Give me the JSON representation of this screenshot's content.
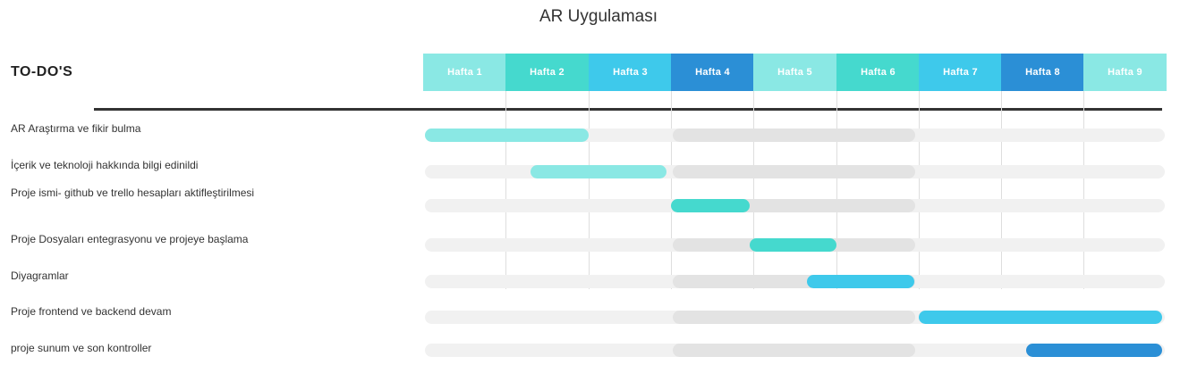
{
  "title": "AR Uygulaması",
  "todo_heading": "TO-DO'S",
  "colors": {
    "week_headers": [
      "#8ae8e4",
      "#45d9ce",
      "#3ec9eb",
      "#2b8fd6",
      "#8ae8e4",
      "#45d9ce",
      "#3ec9eb",
      "#2b8fd6",
      "#8ae8e4"
    ],
    "track": "#f1f1f1",
    "track_mid": "#e3e3e3",
    "divider": "#333333"
  },
  "chart_data": {
    "type": "gantt",
    "weeks": [
      "Hafta 1",
      "Hafta 2",
      "Hafta 3",
      "Hafta 4",
      "Hafta 5",
      "Hafta 6",
      "Hafta 7",
      "Hafta 8",
      "Hafta 9"
    ],
    "tasks": [
      {
        "label": "AR Araştırma ve fikir bulma",
        "start_week": 1.0,
        "end_week": 3.0,
        "color": "#8ae8e4"
      },
      {
        "label": "İçerik ve teknoloji hakkında bilgi edinildi",
        "start_week": 2.3,
        "end_week": 3.95,
        "color": "#8ae8e4"
      },
      {
        "label": "Proje ismi- github ve trello hesapları aktifleştirilmesi",
        "start_week": 4.0,
        "end_week": 4.95,
        "color": "#45d9ce"
      },
      {
        "label": "Proje Dosyaları entegrasyonu ve projeye başlama",
        "start_week": 4.95,
        "end_week": 6.0,
        "color": "#45d9ce"
      },
      {
        "label": "Diyagramlar",
        "start_week": 5.65,
        "end_week": 6.95,
        "color": "#3ec9eb"
      },
      {
        "label": "Proje frontend ve backend devam",
        "start_week": 7.0,
        "end_week": 10.0,
        "color": "#3ec9eb"
      },
      {
        "label": "proje sunum ve son kontroller",
        "start_week": 8.3,
        "end_week": 10.0,
        "color": "#2b8fd6"
      }
    ],
    "highlight_weeks": [
      4,
      6
    ]
  }
}
